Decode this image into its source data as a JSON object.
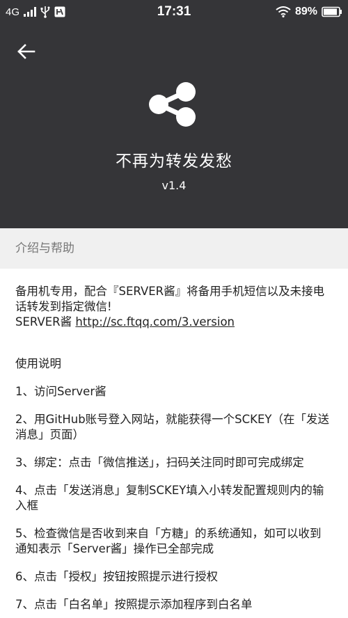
{
  "status_bar": {
    "network": "4G",
    "time": "17:31",
    "battery": "89%"
  },
  "header": {
    "title": "不再为转发发愁",
    "version": "v1.4"
  },
  "section": {
    "title": "介绍与帮助"
  },
  "intro": {
    "line1": "备用机专用，配合『SERVER酱』将备用手机短信以及未接电话转发到指定微信!",
    "line2_prefix": "SERVER酱 ",
    "link": "http://sc.ftqq.com/3.version"
  },
  "instructions": {
    "heading": "使用说明",
    "steps": [
      "1、访问Server酱",
      "2、用GitHub账号登入网站，就能获得一个SCKEY（在「发送消息」页面）",
      "3、绑定：点击「微信推送」，扫码关注同时即可完成绑定",
      "4、点击「发送消息」复制SCKEY填入小转发配置规则内的输入框",
      "5、检查微信是否收到来自「方糖」的系统通知，如可以收到通知表示「Server酱」操作已全部完成",
      "6、点击「授权」按钮按照提示进行授权",
      "7、点击「白名单」按照提示添加程序到白名单"
    ]
  }
}
